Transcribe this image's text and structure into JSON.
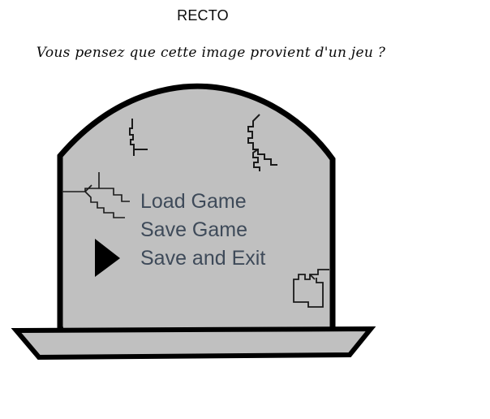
{
  "page": {
    "title": "RECTO",
    "question": "Vous pensez que cette image provient d'un jeu ?",
    "background_color": "#ffffff"
  },
  "illustration": {
    "name": "tombstone-save-menu",
    "stone_fill": "#c0c0c0",
    "stone_outline": "#000000",
    "crack_color": "#1a1a1a",
    "base": {
      "name": "tombstone-base",
      "fill": "#c0c0c0",
      "outline": "#000000"
    },
    "cursor": {
      "name": "selection-arrow",
      "shape": "right-triangle",
      "color": "#000000",
      "points_at": "Save and Exit"
    },
    "cracks": [
      {
        "name": "crack-top-left"
      },
      {
        "name": "crack-top-right"
      },
      {
        "name": "crack-mid-left"
      },
      {
        "name": "crack-bottom-right"
      }
    ]
  },
  "menu": {
    "text_color": "#3e4a59",
    "selected_index": 2,
    "items": [
      {
        "label": "Load Game"
      },
      {
        "label": "Save Game"
      },
      {
        "label": "Save and Exit"
      }
    ]
  }
}
